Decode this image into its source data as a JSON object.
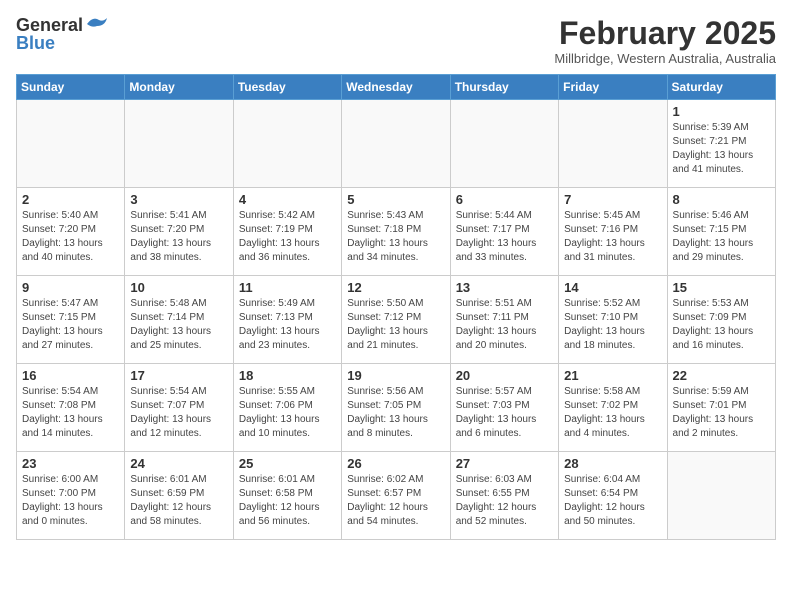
{
  "header": {
    "logo_general": "General",
    "logo_blue": "Blue",
    "month_year": "February 2025",
    "location": "Millbridge, Western Australia, Australia"
  },
  "weekdays": [
    "Sunday",
    "Monday",
    "Tuesday",
    "Wednesday",
    "Thursday",
    "Friday",
    "Saturday"
  ],
  "weeks": [
    [
      {
        "day": "",
        "info": ""
      },
      {
        "day": "",
        "info": ""
      },
      {
        "day": "",
        "info": ""
      },
      {
        "day": "",
        "info": ""
      },
      {
        "day": "",
        "info": ""
      },
      {
        "day": "",
        "info": ""
      },
      {
        "day": "1",
        "info": "Sunrise: 5:39 AM\nSunset: 7:21 PM\nDaylight: 13 hours\nand 41 minutes."
      }
    ],
    [
      {
        "day": "2",
        "info": "Sunrise: 5:40 AM\nSunset: 7:20 PM\nDaylight: 13 hours\nand 40 minutes."
      },
      {
        "day": "3",
        "info": "Sunrise: 5:41 AM\nSunset: 7:20 PM\nDaylight: 13 hours\nand 38 minutes."
      },
      {
        "day": "4",
        "info": "Sunrise: 5:42 AM\nSunset: 7:19 PM\nDaylight: 13 hours\nand 36 minutes."
      },
      {
        "day": "5",
        "info": "Sunrise: 5:43 AM\nSunset: 7:18 PM\nDaylight: 13 hours\nand 34 minutes."
      },
      {
        "day": "6",
        "info": "Sunrise: 5:44 AM\nSunset: 7:17 PM\nDaylight: 13 hours\nand 33 minutes."
      },
      {
        "day": "7",
        "info": "Sunrise: 5:45 AM\nSunset: 7:16 PM\nDaylight: 13 hours\nand 31 minutes."
      },
      {
        "day": "8",
        "info": "Sunrise: 5:46 AM\nSunset: 7:15 PM\nDaylight: 13 hours\nand 29 minutes."
      }
    ],
    [
      {
        "day": "9",
        "info": "Sunrise: 5:47 AM\nSunset: 7:15 PM\nDaylight: 13 hours\nand 27 minutes."
      },
      {
        "day": "10",
        "info": "Sunrise: 5:48 AM\nSunset: 7:14 PM\nDaylight: 13 hours\nand 25 minutes."
      },
      {
        "day": "11",
        "info": "Sunrise: 5:49 AM\nSunset: 7:13 PM\nDaylight: 13 hours\nand 23 minutes."
      },
      {
        "day": "12",
        "info": "Sunrise: 5:50 AM\nSunset: 7:12 PM\nDaylight: 13 hours\nand 21 minutes."
      },
      {
        "day": "13",
        "info": "Sunrise: 5:51 AM\nSunset: 7:11 PM\nDaylight: 13 hours\nand 20 minutes."
      },
      {
        "day": "14",
        "info": "Sunrise: 5:52 AM\nSunset: 7:10 PM\nDaylight: 13 hours\nand 18 minutes."
      },
      {
        "day": "15",
        "info": "Sunrise: 5:53 AM\nSunset: 7:09 PM\nDaylight: 13 hours\nand 16 minutes."
      }
    ],
    [
      {
        "day": "16",
        "info": "Sunrise: 5:54 AM\nSunset: 7:08 PM\nDaylight: 13 hours\nand 14 minutes."
      },
      {
        "day": "17",
        "info": "Sunrise: 5:54 AM\nSunset: 7:07 PM\nDaylight: 13 hours\nand 12 minutes."
      },
      {
        "day": "18",
        "info": "Sunrise: 5:55 AM\nSunset: 7:06 PM\nDaylight: 13 hours\nand 10 minutes."
      },
      {
        "day": "19",
        "info": "Sunrise: 5:56 AM\nSunset: 7:05 PM\nDaylight: 13 hours\nand 8 minutes."
      },
      {
        "day": "20",
        "info": "Sunrise: 5:57 AM\nSunset: 7:03 PM\nDaylight: 13 hours\nand 6 minutes."
      },
      {
        "day": "21",
        "info": "Sunrise: 5:58 AM\nSunset: 7:02 PM\nDaylight: 13 hours\nand 4 minutes."
      },
      {
        "day": "22",
        "info": "Sunrise: 5:59 AM\nSunset: 7:01 PM\nDaylight: 13 hours\nand 2 minutes."
      }
    ],
    [
      {
        "day": "23",
        "info": "Sunrise: 6:00 AM\nSunset: 7:00 PM\nDaylight: 13 hours\nand 0 minutes."
      },
      {
        "day": "24",
        "info": "Sunrise: 6:01 AM\nSunset: 6:59 PM\nDaylight: 12 hours\nand 58 minutes."
      },
      {
        "day": "25",
        "info": "Sunrise: 6:01 AM\nSunset: 6:58 PM\nDaylight: 12 hours\nand 56 minutes."
      },
      {
        "day": "26",
        "info": "Sunrise: 6:02 AM\nSunset: 6:57 PM\nDaylight: 12 hours\nand 54 minutes."
      },
      {
        "day": "27",
        "info": "Sunrise: 6:03 AM\nSunset: 6:55 PM\nDaylight: 12 hours\nand 52 minutes."
      },
      {
        "day": "28",
        "info": "Sunrise: 6:04 AM\nSunset: 6:54 PM\nDaylight: 12 hours\nand 50 minutes."
      },
      {
        "day": "",
        "info": ""
      }
    ]
  ]
}
